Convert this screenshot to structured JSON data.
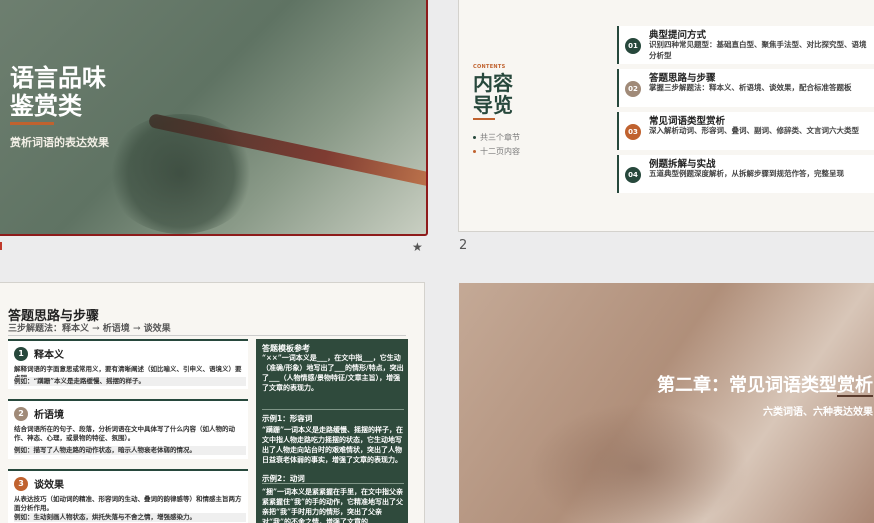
{
  "slide1": {
    "title_line1": "语言品味",
    "title_line2": "鉴赏类",
    "subtitle": "赏析词语的表达效果"
  },
  "star": "★",
  "slide2_number": "2",
  "slide2": {
    "contents_label": "CONTENTS",
    "title_line1": "内容",
    "title_line2": "导览",
    "notes": [
      "共三个章节",
      "十二页内容"
    ],
    "items": [
      {
        "num": "01",
        "color": "#27483c",
        "title": "典型提问方式",
        "desc": "识别四种常见题型：基础直白型、聚焦手法型、对比探究型、语境分析型"
      },
      {
        "num": "02",
        "color": "#a08a78",
        "title": "答题思路与步骤",
        "desc": "掌握三步解题法：释本义、析语境、谈效果，配合标准答题板"
      },
      {
        "num": "03",
        "color": "#c0622f",
        "title": "常见词语类型赏析",
        "desc": "深入解析动词、形容词、叠词、副词、修辞类、文言词六大类型"
      },
      {
        "num": "04",
        "color": "#27483c",
        "title": "例题拆解与实战",
        "desc": "五道典型例题深度解析，从拆解步骤到规范作答，完整呈现"
      }
    ]
  },
  "slide3": {
    "title": "答题思路与步骤",
    "subtitle": "三步解题法：释本义 → 析语境 → 谈效果",
    "steps": [
      {
        "num": "1",
        "color": "#27483c",
        "name": "释本义",
        "desc": "解释词语的字面意思或常用义，要有清晰阐述（如比喻义、引申义、语境义）要点明。",
        "example": "例如：“蹒跚”本义是走路缓慢、摇摆的样子。"
      },
      {
        "num": "2",
        "color": "#a08a78",
        "name": "析语境",
        "desc": "结合词语所在的句子、段落，分析词语在文中具体写了什么内容（如人物的动作、神态、心理，或景物的特征、氛围）。",
        "example": "例如：描写了人物走路的动作状态，暗示人物衰老体弱的情况。"
      },
      {
        "num": "3",
        "color": "#c0622f",
        "name": "谈效果",
        "desc": "从表达技巧（如动词的精准、形容词的生动、叠词的韵律感等）和情感主旨两方面分析作用。",
        "example": "例如：生动刻画人物状态，烘托失落与不舍之情，增强感染力。"
      }
    ],
    "panel": {
      "title": "答题模板参考",
      "template": "“××”一词本义是___，在文中指___，它生动（准确/形象）地写出了___的情形/特点，突出了___（人物情感/景物特征/文章主旨），增强了文章的表现力。",
      "example1_label": "示例1：形容词",
      "example1": "“蹒跚”一词本义是走路缓慢、摇摆的样子，在文中指人物走路吃力摇摆的状态，它生动地写出了人物走向站台时的艰难情状，突出了人物日益衰老体弱的事实，增强了文章的表现力。",
      "example2_label": "示例2：动词",
      "example2": "“捆”一词本义是紧紧握在手里，在文中指父亲紧紧握住“我”的手的动作，它精准地写出了父亲把“我”手时用力的情形，突出了父亲对“我”的不舍之情，增强了文章的"
    }
  },
  "slide4": {
    "title": "第二章：常见词语类型赏析",
    "subtitle": "六类词语、六种表达效果"
  }
}
